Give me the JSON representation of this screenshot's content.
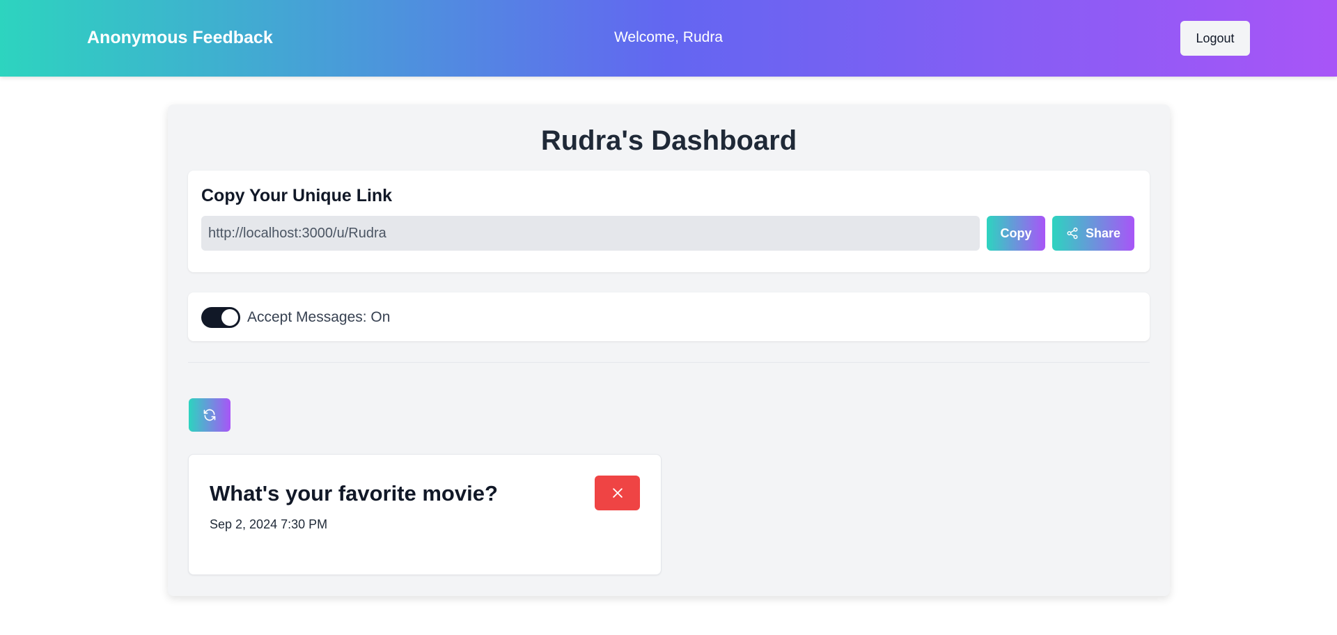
{
  "navbar": {
    "brand": "Anonymous Feedback",
    "welcome": "Welcome, Rudra",
    "logout_label": "Logout"
  },
  "dashboard": {
    "title": "Rudra's Dashboard",
    "link_section": {
      "heading": "Copy Your Unique Link",
      "url_value": "http://localhost:3000/u/Rudra",
      "copy_label": "Copy",
      "share_label": "Share",
      "share_icon": "share-icon"
    },
    "accept_messages": {
      "enabled": true,
      "label": "Accept Messages: On"
    },
    "refresh_icon": "refresh-icon",
    "messages": [
      {
        "content": "What's your favorite movie?",
        "date": "Sep 2, 2024 7:30 PM",
        "delete_icon": "close-icon"
      }
    ]
  },
  "colors": {
    "gradient_start": "#2dd4bf",
    "gradient_mid": "#6366f1",
    "gradient_end": "#a855f7",
    "delete_red": "#ef4444",
    "switch_on": "#111827"
  }
}
